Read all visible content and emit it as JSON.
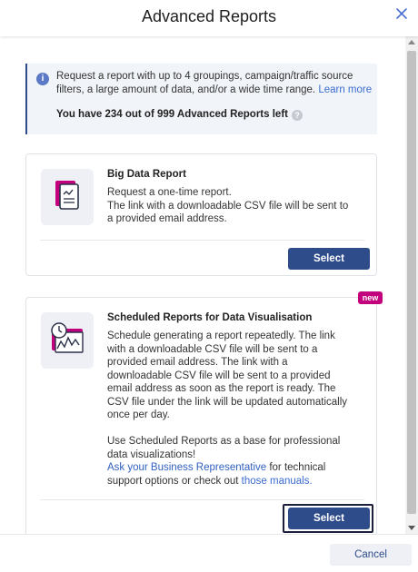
{
  "dialog": {
    "title": "Advanced Reports",
    "close_icon": "close-icon"
  },
  "info": {
    "icon": "info-icon",
    "text": "Request a report with up to 4 groupings, campaign/traffic source filters, a large amount of data, and/or a wide time range.",
    "learn_more": "Learn more",
    "reports_left": "You have 234 out of 999 Advanced Reports left",
    "help_icon": "help-icon"
  },
  "big_data": {
    "icon": "document-chart-icon",
    "title": "Big Data Report",
    "line1": "Request a one-time report.",
    "line2": "The link with a downloadable CSV file will be sent to a provided email address.",
    "select_label": "Select"
  },
  "scheduled": {
    "icon": "clock-chart-icon",
    "badge": "new",
    "title": "Scheduled Reports for Data Visualisation",
    "para1": "Schedule generating a report repeatedly. The link with a downloadable CSV file will be sent to a provided email address. The link with a downloadable CSV file will be sent to a provided email address as soon as the report is ready. The CSV file under the link will be updated automatically once per day.",
    "para2": "Use Scheduled Reports as a base for professional data visualizations!",
    "link_rep": "Ask your Business Representative",
    "mid_text": " for technical support options or check out ",
    "link_manuals": "those manuals.",
    "select_label": "Select"
  },
  "footer": {
    "cancel_label": "Cancel"
  },
  "colors": {
    "primary": "#2e4b8a",
    "link": "#3b6bd0",
    "badge": "#c2007e",
    "icon_magenta": "#c2007e"
  }
}
